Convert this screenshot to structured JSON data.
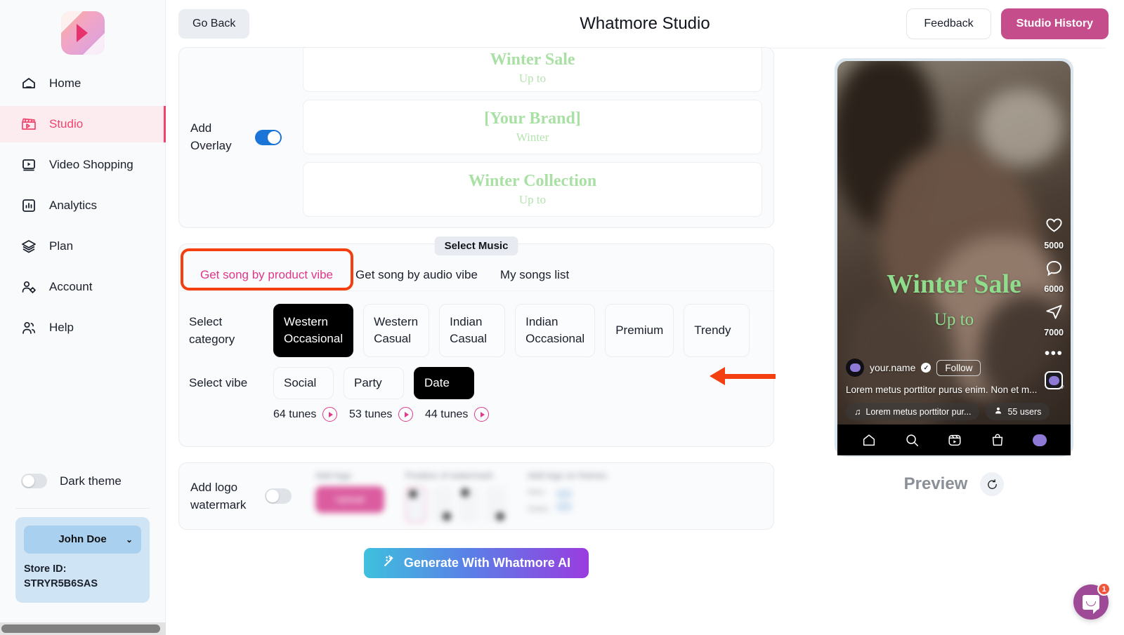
{
  "sidebar": {
    "logo_name": "whatmore-logo",
    "items": [
      {
        "label": "Home",
        "icon": "home-icon",
        "active": false
      },
      {
        "label": "Studio",
        "icon": "clapperboard-icon",
        "active": true
      },
      {
        "label": "Video Shopping",
        "icon": "video-play-icon",
        "active": false
      },
      {
        "label": "Analytics",
        "icon": "bar-chart-icon",
        "active": false
      },
      {
        "label": "Plan",
        "icon": "layers-icon",
        "active": false
      },
      {
        "label": "Account",
        "icon": "user-gear-icon",
        "active": false
      },
      {
        "label": "Help",
        "icon": "users-icon",
        "active": false
      }
    ],
    "dark_theme_label": "Dark theme",
    "dark_theme_on": false,
    "user_name": "John Doe",
    "store_id_label": "Store ID:",
    "store_id_value": "STRYR5B6SAS"
  },
  "header": {
    "go_back": "Go Back",
    "title": "Whatmore Studio",
    "feedback": "Feedback",
    "studio_history": "Studio History"
  },
  "overlay": {
    "label": "Add\nOverlay",
    "label_line1": "Add",
    "label_line2": "Overlay",
    "enabled": true,
    "options": [
      {
        "title": "Winter Sale",
        "sub": "Up to"
      },
      {
        "title": "[Your Brand]",
        "sub": "Winter"
      },
      {
        "title": "Winter Collection",
        "sub": "Up to"
      }
    ]
  },
  "music": {
    "section_title": "Select Music",
    "tabs": [
      {
        "label": "Get song by product vibe",
        "active": true,
        "highlighted": true
      },
      {
        "label": "Get song by audio vibe",
        "active": false,
        "highlighted": false
      },
      {
        "label": "My songs list",
        "active": false,
        "highlighted": false
      }
    ],
    "category_label_line1": "Select",
    "category_label_line2": "category",
    "categories": [
      {
        "line1": "Western",
        "line2": "Occasional",
        "selected": true
      },
      {
        "line1": "Western",
        "line2": "Casual",
        "selected": false
      },
      {
        "line1": "Indian",
        "line2": "Casual",
        "selected": false
      },
      {
        "line1": "Indian",
        "line2": "Occasional",
        "selected": false
      },
      {
        "line1": "Premium",
        "line2": "",
        "selected": false
      },
      {
        "line1": "Trendy",
        "line2": "",
        "selected": false
      }
    ],
    "vibe_label": "Select vibe",
    "vibes": [
      {
        "label": "Social",
        "selected": false,
        "tunes": "64 tunes"
      },
      {
        "label": "Party",
        "selected": false,
        "tunes": "53 tunes"
      },
      {
        "label": "Date",
        "selected": true,
        "tunes": "44 tunes"
      }
    ]
  },
  "watermark": {
    "label_line1": "Add logo",
    "label_line2": "watermark",
    "enabled": false,
    "add_logo_caption": "Add logo",
    "upload_label": "Upload",
    "position_caption": "Position of watermark",
    "frames_caption": "Add logo on frames",
    "frames_options": [
      "Intro",
      "Outro"
    ]
  },
  "generate": {
    "label": "Generate With Whatmore AI",
    "icon": "magic-wand-icon"
  },
  "preview": {
    "label": "Preview",
    "refresh_icon": "refresh-icon",
    "overlay_title": "Winter Sale",
    "overlay_sub": "Up to",
    "username": "your.name",
    "follow_label": "Follow",
    "caption": "Lorem metus porttitor purus enim. Non et m...",
    "music_pill": "Lorem metus porttitor pur...",
    "users_pill": "55 users",
    "rail": [
      {
        "icon": "heart-icon",
        "count": "5000"
      },
      {
        "icon": "comment-icon",
        "count": "6000"
      },
      {
        "icon": "share-icon",
        "count": "7000"
      }
    ],
    "more_icon": "more-dots-icon",
    "navbar": [
      "home-icon",
      "search-icon",
      "reels-icon",
      "shop-bag-icon",
      "profile-icon"
    ]
  },
  "intercom": {
    "icon": "chat-bubble-icon",
    "badge": "1"
  },
  "colors": {
    "accent_pink": "#e0368a",
    "brand_magenta": "#c64d8b",
    "active_nav": "#f0436e",
    "highlight_red": "#f44011",
    "toggle_blue": "#1b74d8",
    "overlay_green": "#8fdc8c"
  }
}
